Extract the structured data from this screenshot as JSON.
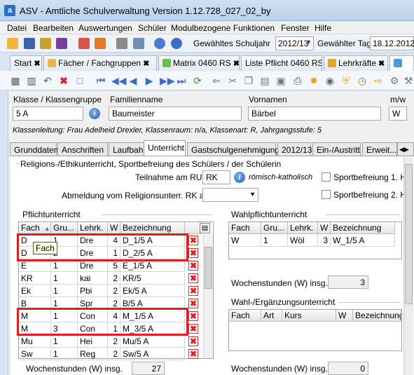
{
  "window": {
    "title": "ASV - Amtliche Schulverwaltung Version 1.12.728_027_02_by",
    "app_icon": "a"
  },
  "menu": [
    "Datei",
    "Bearbeiten",
    "Auswertungen",
    "Schüler",
    "Modulbezogene Funktionen",
    "Fenster",
    "Hilfe"
  ],
  "toolbar": {
    "schuljahr_label": "Gewähltes Schuljahr",
    "schuljahr_value": "2012/13",
    "tag_label": "Gewählter Tag",
    "tag_value": "18.12.2012"
  },
  "doc_tabs": [
    {
      "label": "Start",
      "icon": "home-icon"
    },
    {
      "label": "Fächer / Fachgruppen",
      "icon": "folder-icon"
    },
    {
      "label": "Matrix 0460 RS",
      "icon": "matrix-icon"
    },
    {
      "label": "Liste Pflicht 0460 RS",
      "icon": "list-icon"
    },
    {
      "label": "Lehrkräfte",
      "icon": "teachers-icon"
    }
  ],
  "student": {
    "klasse_label": "Klasse / Klassengruppe",
    "klasse": "5 A",
    "familienname_label": "Familienname",
    "familienname": "Baumeister",
    "vorname_label": "Vornamen",
    "vorname": "Bärbel",
    "geschlecht_label": "m/w",
    "geschlecht": "W",
    "info_line": "Klassenleitung: Frau Adelheid Drexler, Klassenraum: n/a, Klassenart: R, Jahrgangsstufe: 5"
  },
  "detail_tabs": [
    "Grunddaten",
    "Anschriften",
    "Laufbahn",
    "Unterricht",
    "Gastschulgenehmigung",
    "2012/13",
    "Ein-/Austritt",
    "Erweit..."
  ],
  "active_tab": "Unterricht",
  "religion": {
    "group_title": "Religions-/Ethikunterricht, Sportbefreiung des Schülers / der Schülerin",
    "teilnahme_label": "Teilnahme am RU",
    "teilnahme_value": "RK",
    "teilnahme_text": "römisch-katholisch",
    "abmeldung_label": "Abmeldung vom Religionsunterr. RK am",
    "abmeldung_value": "",
    "sport1_label": "Sportbefreiung 1. H",
    "sport2_label": "Sportbefreiung 2. H"
  },
  "pflicht": {
    "group_title": "Pflichtunterricht",
    "headers": [
      "Fach",
      "Gru...",
      "Lehrk.",
      "W",
      "Bezeichnung"
    ],
    "rows": [
      [
        "D",
        "1",
        "Dre",
        "4",
        "D_1/5 A"
      ],
      [
        "D",
        "2",
        "Dre",
        "1",
        "D_2/5 A"
      ],
      [
        "E",
        "1",
        "Dre",
        "5",
        "E_1/5 A"
      ],
      [
        "KR",
        "1",
        "kai",
        "2",
        "KR/5"
      ],
      [
        "Ek",
        "1",
        "Pbi",
        "2",
        "Ek/5 A"
      ],
      [
        "B",
        "1",
        "Spr",
        "2",
        "B/5 A"
      ],
      [
        "M",
        "1",
        "Con",
        "4",
        "M_1/5 A"
      ],
      [
        "M",
        "3",
        "Con",
        "1",
        "M_3/5 A"
      ],
      [
        "Mu",
        "1",
        "Hei",
        "2",
        "Mu/5 A"
      ],
      [
        "Sw",
        "1",
        "Reg",
        "2",
        "Sw/5 A"
      ]
    ],
    "sum_label": "Wochenstunden (W) insg.",
    "sum_value": "27",
    "tooltip": "Fach"
  },
  "wahlpflicht": {
    "group_title": "Wahlpflichtunterricht",
    "headers": [
      "Fach",
      "Gru...",
      "Lehrk.",
      "W",
      "Bezeichnung"
    ],
    "rows": [
      [
        "W",
        "1",
        "Wöl",
        "3",
        "W_1/5 A"
      ]
    ],
    "sum_label": "Wochenstunden (W) insg.",
    "sum_value": "3"
  },
  "wahl": {
    "group_title": "Wahl-/Ergänzungsunterricht",
    "headers": [
      "Fach",
      "Art",
      "Kurs",
      "W",
      "Bezeichnung"
    ],
    "sum_label": "Wochenstunden (W) insg.",
    "sum_value": "0"
  }
}
